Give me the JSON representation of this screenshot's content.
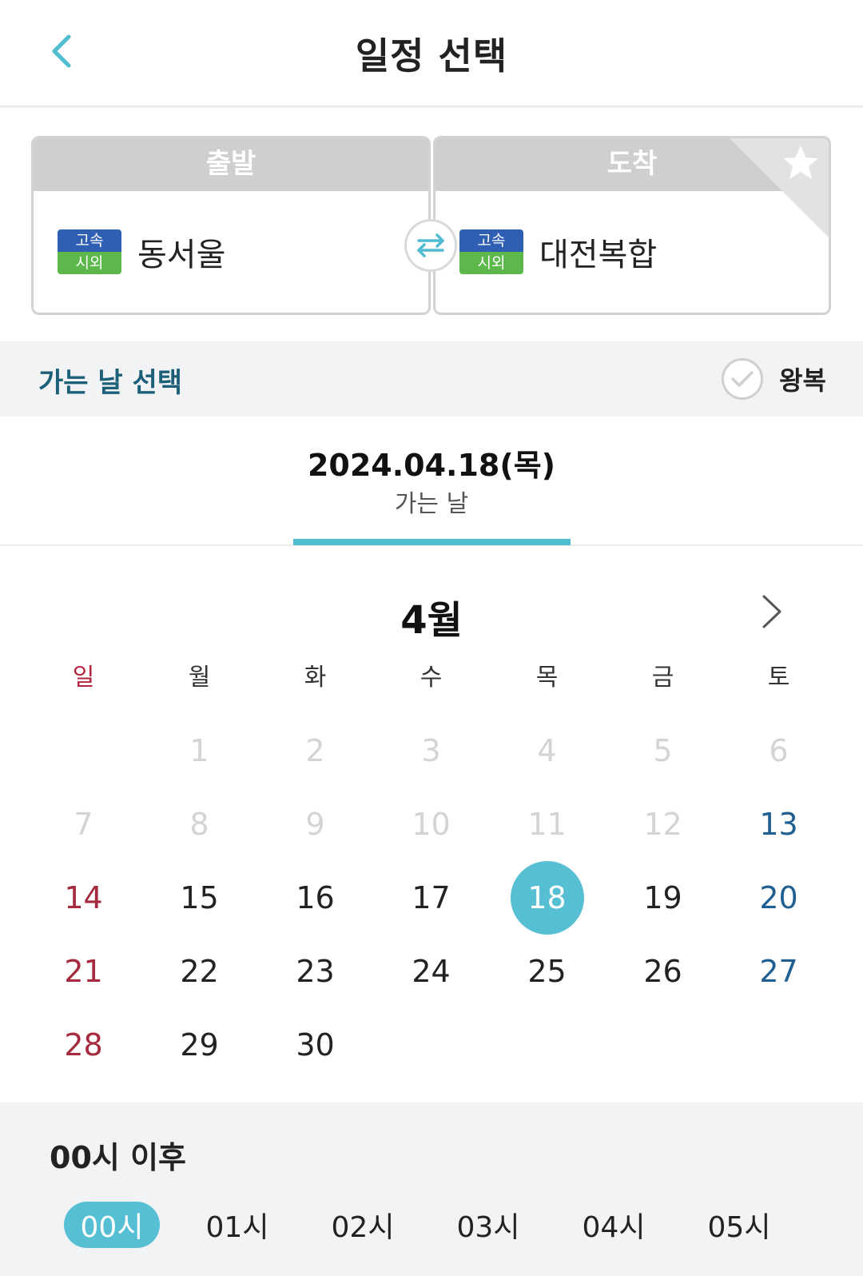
{
  "header": {
    "title": "일정 선택",
    "back_icon": "chevron-left-icon"
  },
  "route": {
    "departure": {
      "header": "출발",
      "badge_top": "고속",
      "badge_bottom": "시외",
      "station": "동서울"
    },
    "arrival": {
      "header": "도착",
      "badge_top": "고속",
      "badge_bottom": "시외",
      "station": "대전복합"
    },
    "swap_icon": "swap-arrows-icon",
    "favorite_icon": "star-icon"
  },
  "date_select": {
    "title": "가는 날 선택",
    "roundtrip_label": "왕복",
    "roundtrip_checked": false
  },
  "date_tab": {
    "date": "2024.04.18(목)",
    "label": "가는 날"
  },
  "calendar": {
    "month": "4월",
    "weekdays": [
      "일",
      "월",
      "화",
      "수",
      "목",
      "금",
      "토"
    ],
    "weeks": [
      [
        "",
        "1",
        "2",
        "3",
        "4",
        "5",
        "6"
      ],
      [
        "7",
        "8",
        "9",
        "10",
        "11",
        "12",
        "13"
      ],
      [
        "14",
        "15",
        "16",
        "17",
        "18",
        "19",
        "20"
      ],
      [
        "21",
        "22",
        "23",
        "24",
        "25",
        "26",
        "27"
      ],
      [
        "28",
        "29",
        "30",
        "",
        "",
        "",
        ""
      ]
    ],
    "selected_day": "18",
    "disabled_days": [
      "1",
      "2",
      "3",
      "4",
      "5",
      "6",
      "7",
      "8",
      "9",
      "10",
      "11",
      "12"
    ]
  },
  "time": {
    "title": "00시 이후",
    "options": [
      "00시",
      "01시",
      "02시",
      "03시",
      "04시",
      "05시"
    ],
    "selected": "00시"
  },
  "colors": {
    "accent": "#56bfd3",
    "sunday": "#a52a40",
    "saturday": "#1f5f92",
    "title_teal": "#1c5f78"
  }
}
